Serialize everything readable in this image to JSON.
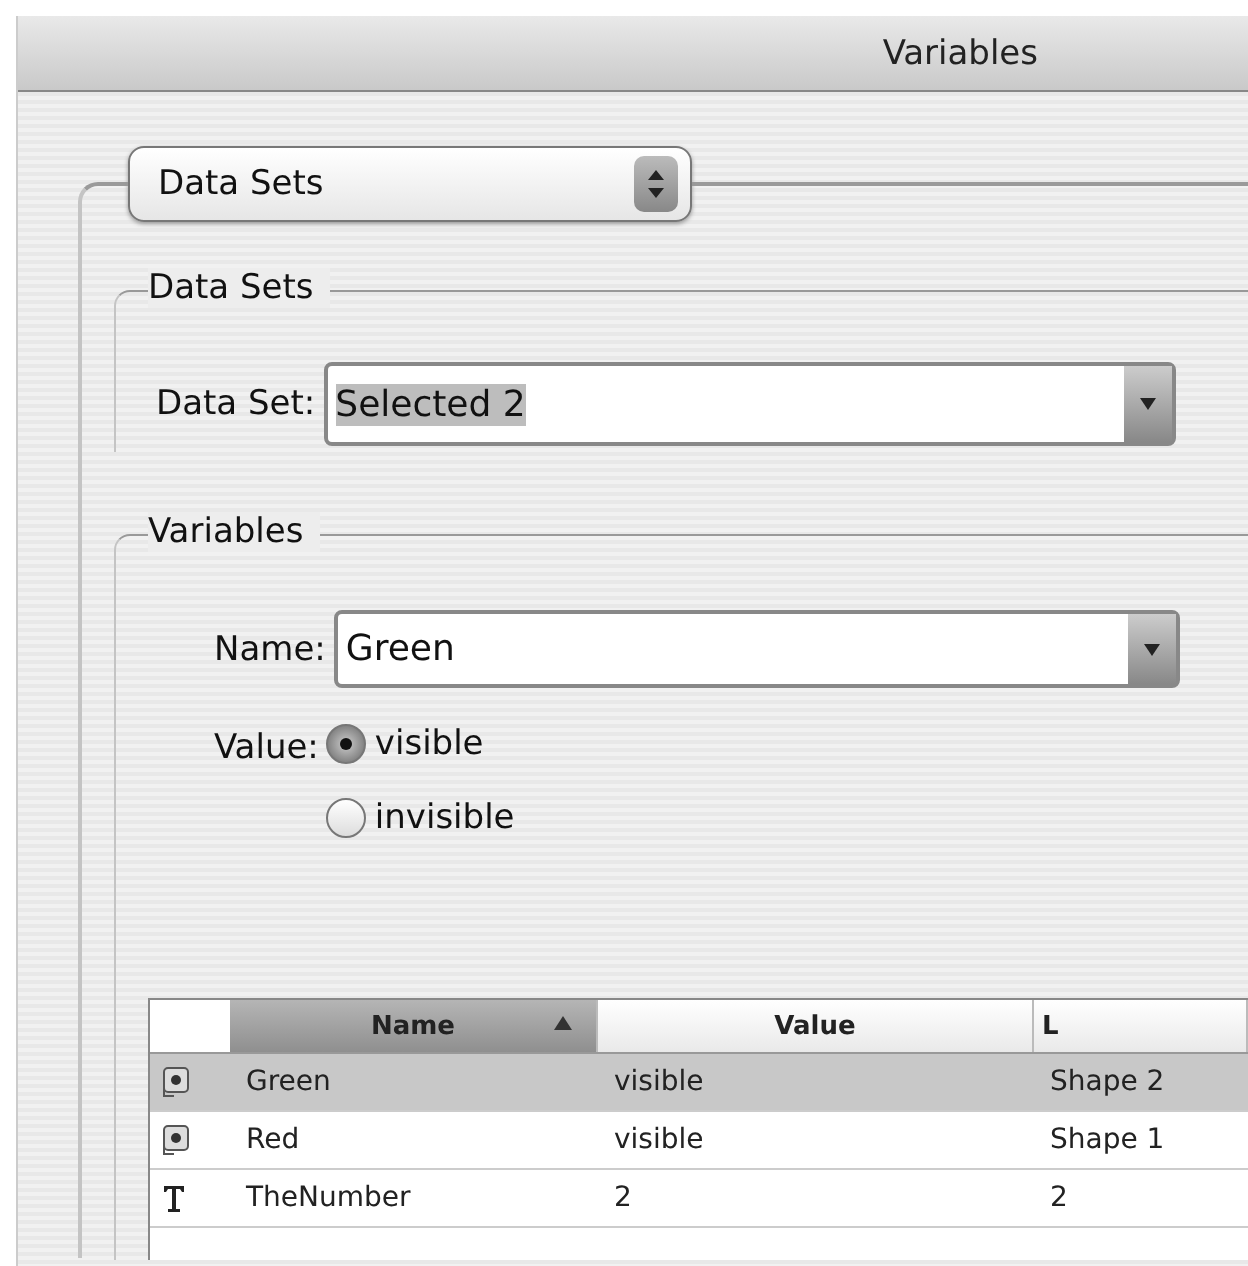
{
  "window": {
    "title": "Variables"
  },
  "mode_popup": {
    "value": "Data Sets"
  },
  "data_sets_group": {
    "title": "Data Sets",
    "data_set": {
      "label": "Data Set:",
      "value": "Selected 2"
    }
  },
  "variables_group": {
    "title": "Variables",
    "name": {
      "label": "Name:",
      "value": "Green"
    },
    "value": {
      "label": "Value:",
      "options": [
        {
          "label": "visible",
          "selected": true
        },
        {
          "label": "invisible",
          "selected": false
        }
      ]
    }
  },
  "table": {
    "columns": [
      {
        "label": "Name",
        "sorted": true
      },
      {
        "label": "Value",
        "sorted": false
      },
      {
        "label": "L",
        "sorted": false
      }
    ],
    "rows": [
      {
        "kind": "visibility",
        "cells": [
          "Green",
          "visible",
          "Shape 2"
        ],
        "selected": true
      },
      {
        "kind": "visibility",
        "cells": [
          "Red",
          "visible",
          "Shape 1"
        ],
        "selected": false
      },
      {
        "kind": "text",
        "cells": [
          "TheNumber",
          "2",
          "2"
        ],
        "selected": false
      }
    ]
  }
}
